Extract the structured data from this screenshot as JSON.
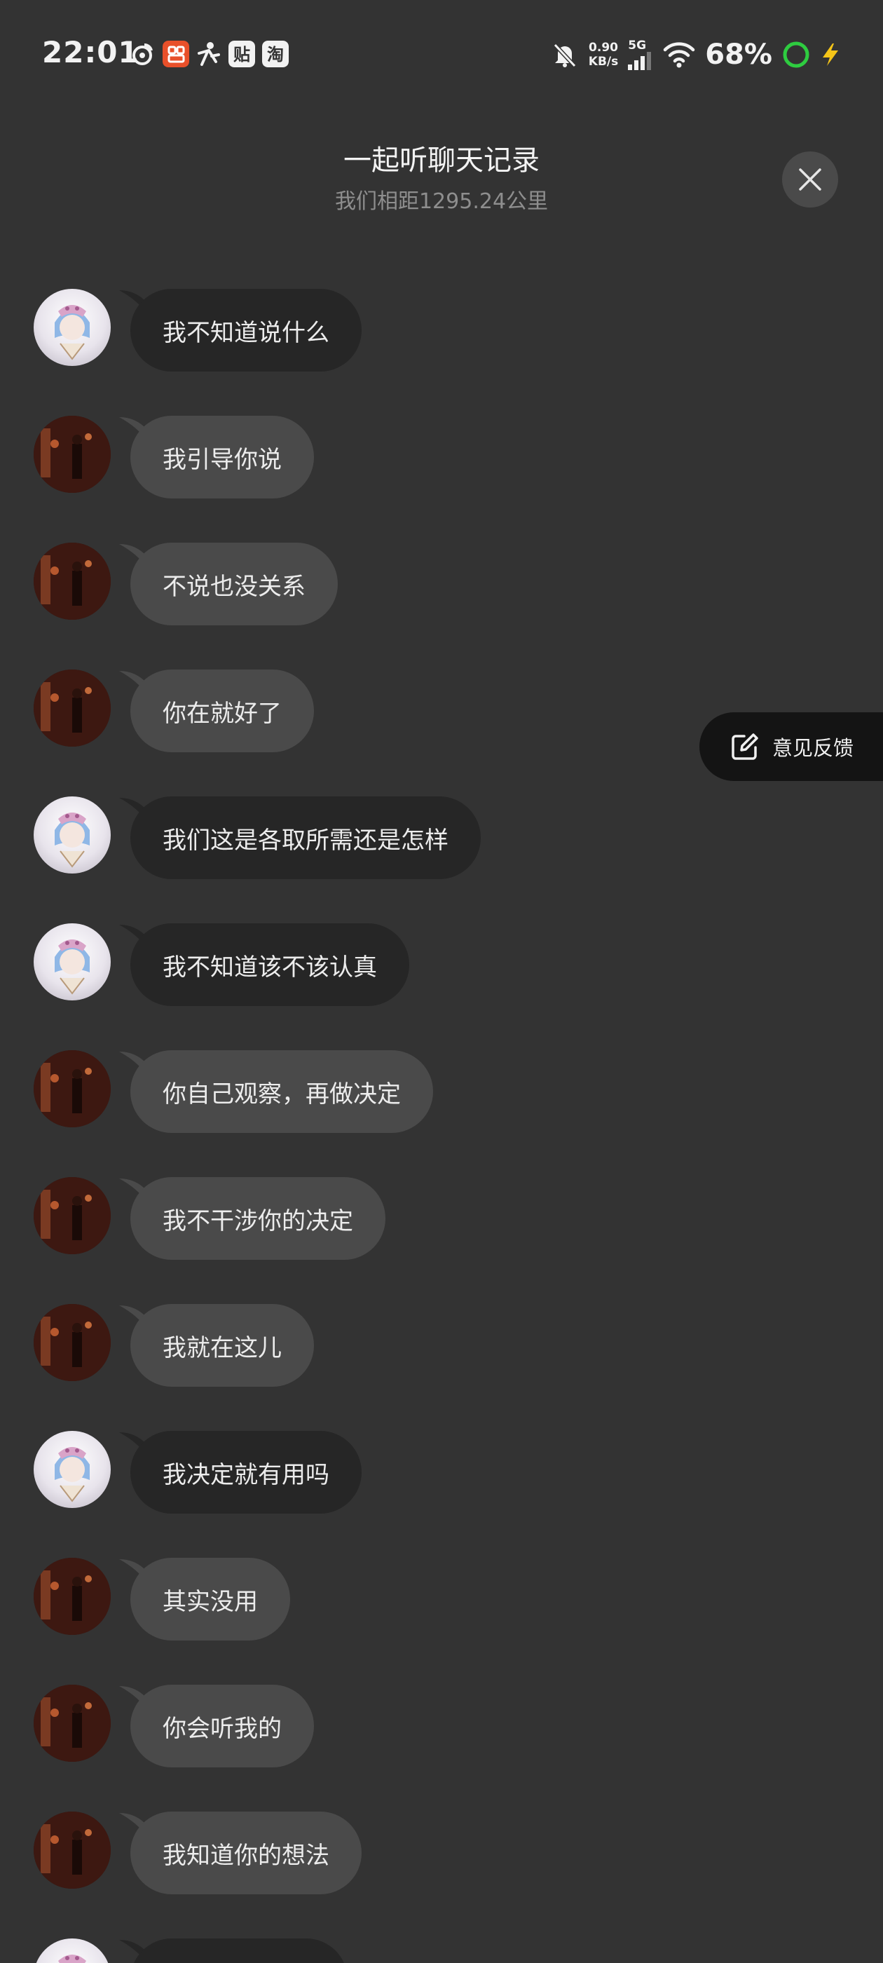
{
  "status_bar": {
    "time": "22:01",
    "net_speed_value": "0.90",
    "net_speed_unit": "KB/s",
    "network_type": "5G",
    "battery": "68%",
    "colors": {
      "charging_ring": "#2ecc40",
      "bolt": "#f5c518",
      "app_red": "#e8502a"
    }
  },
  "header": {
    "title": "一起听聊天记录",
    "subtitle": "我们相距1295.24公里",
    "close_icon": "close-icon"
  },
  "feedback": {
    "label": "意见反馈",
    "icon": "edit-icon"
  },
  "messages": [
    {
      "text": "我不知道说什么",
      "avatar": "a",
      "style": "dark"
    },
    {
      "text": "我引导你说",
      "avatar": "b",
      "style": "light"
    },
    {
      "text": "不说也没关系",
      "avatar": "b",
      "style": "light"
    },
    {
      "text": "你在就好了",
      "avatar": "b",
      "style": "light"
    },
    {
      "text": "我们这是各取所需还是怎样",
      "avatar": "a",
      "style": "dark"
    },
    {
      "text": "我不知道该不该认真",
      "avatar": "a",
      "style": "dark"
    },
    {
      "text": "你自己观察，再做决定",
      "avatar": "b",
      "style": "light"
    },
    {
      "text": "我不干涉你的决定",
      "avatar": "b",
      "style": "light"
    },
    {
      "text": "我就在这儿",
      "avatar": "b",
      "style": "light"
    },
    {
      "text": "我决定就有用吗",
      "avatar": "a",
      "style": "dark"
    },
    {
      "text": "其实没用",
      "avatar": "b",
      "style": "light"
    },
    {
      "text": "你会听我的",
      "avatar": "b",
      "style": "light"
    },
    {
      "text": "我知道你的想法",
      "avatar": "b",
      "style": "light"
    },
    {
      "text": "",
      "avatar": "a",
      "style": "dark"
    }
  ]
}
